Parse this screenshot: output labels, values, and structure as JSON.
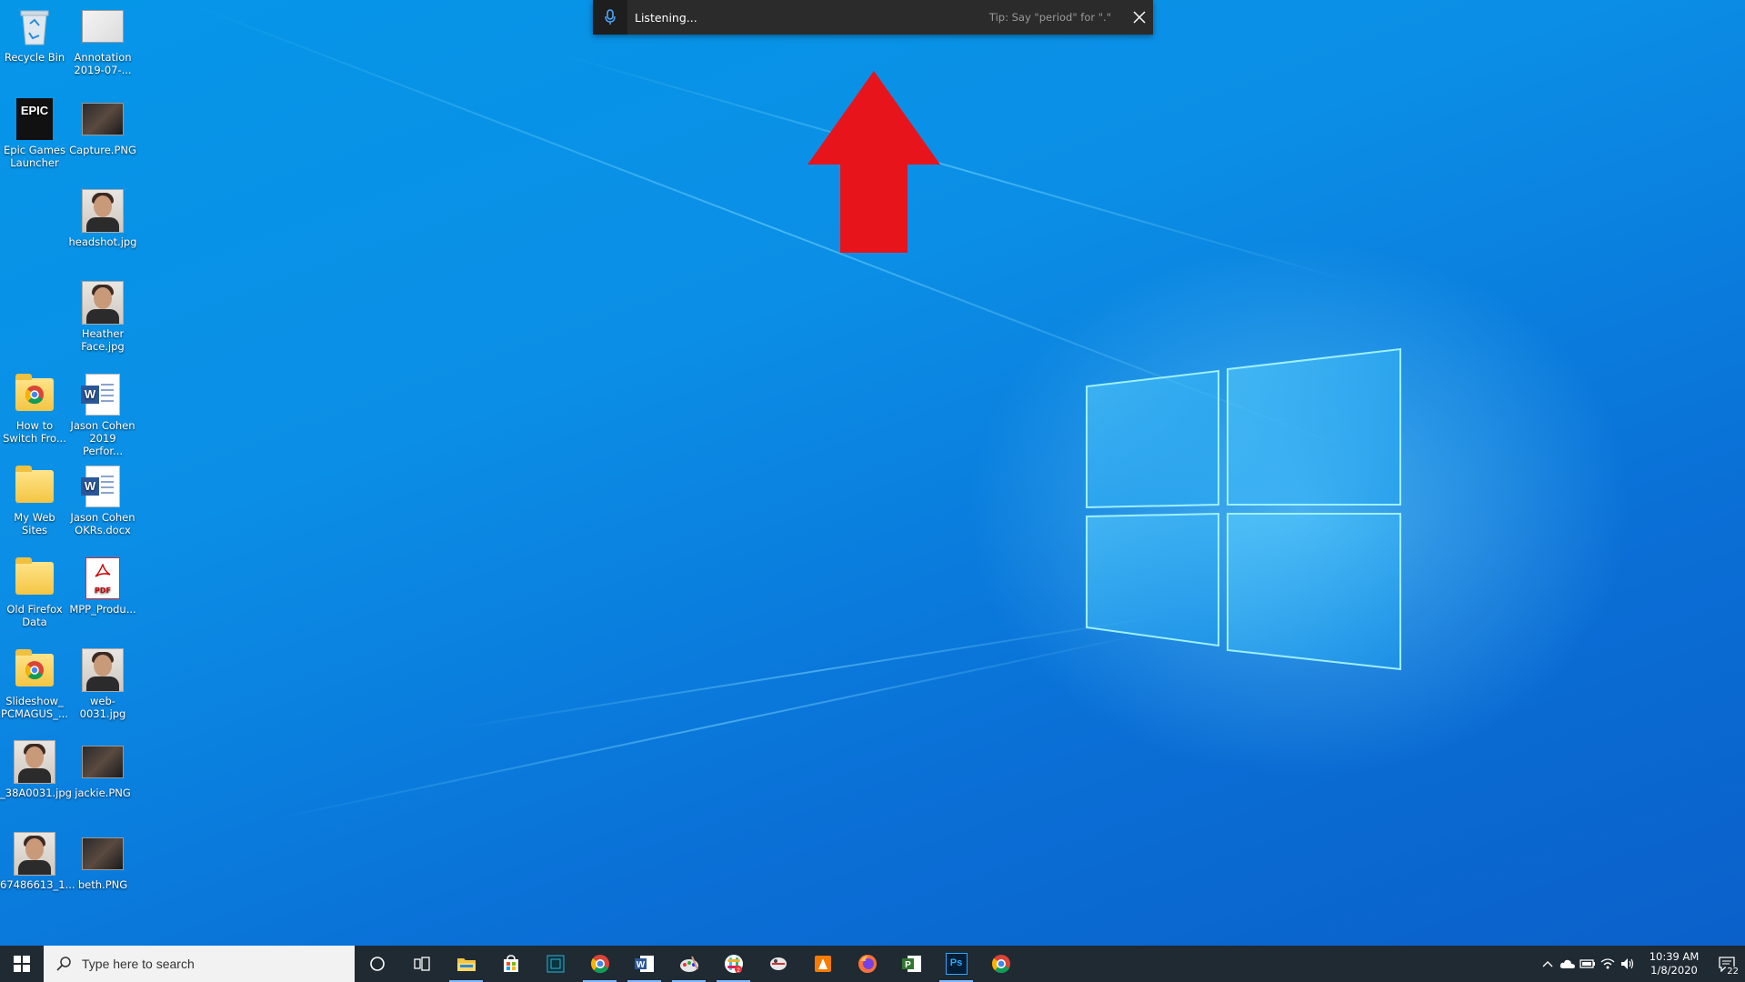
{
  "desktop_icons": [
    {
      "label": "Recycle Bin",
      "icon": "recycle-bin-icon"
    },
    {
      "label": "Annotation\n2019-07-...",
      "icon": "image-file-icon"
    },
    {
      "label": "Epic Games\nLauncher",
      "icon": "epic-games-icon",
      "logo_text": "EPIC"
    },
    {
      "label": "Capture.PNG",
      "icon": "image-file-icon"
    },
    {
      "label": "headshot.jpg",
      "icon": "photo-icon"
    },
    {
      "label": "Heather\nFace.jpg",
      "icon": "photo-icon"
    },
    {
      "label": "How to\nSwitch Fro...",
      "icon": "chrome-folder-icon"
    },
    {
      "label": "Jason Cohen\n2019 Perfor...",
      "icon": "word-doc-icon"
    },
    {
      "label": "My Web Sites",
      "icon": "folder-icon"
    },
    {
      "label": "Jason Cohen\nOKRs.docx",
      "icon": "word-doc-icon"
    },
    {
      "label": "Old Firefox\nData",
      "icon": "folder-icon"
    },
    {
      "label": "MPP_Produ...",
      "icon": "pdf-icon"
    },
    {
      "label": "Slideshow_\nPCMAGUS_...",
      "icon": "chrome-folder-icon"
    },
    {
      "label": "web-0031.jpg",
      "icon": "photo-icon"
    },
    {
      "label": "_38A0031.jpg",
      "icon": "photo-icon"
    },
    {
      "label": "jackie.PNG",
      "icon": "image-file-icon"
    },
    {
      "label": "67486613_1...",
      "icon": "photo-icon"
    },
    {
      "label": "beth.PNG",
      "icon": "image-file-icon"
    }
  ],
  "voice_bar": {
    "status": "Listening...",
    "tip": "Tip: Say \"period\" for \".\"",
    "mic_icon": "microphone-icon",
    "close_icon": "close-icon"
  },
  "taskbar": {
    "search_placeholder": "Type here to search",
    "apps": [
      {
        "name": "cortana",
        "icon": "cortana-icon",
        "active": false
      },
      {
        "name": "task-view",
        "icon": "task-view-icon",
        "active": false
      },
      {
        "name": "file-explorer",
        "icon": "folder-icon",
        "active": true
      },
      {
        "name": "store",
        "icon": "store-icon",
        "active": false
      },
      {
        "name": "app-dark",
        "icon": "app-icon",
        "active": false
      },
      {
        "name": "chrome",
        "icon": "chrome-icon",
        "active": true
      },
      {
        "name": "word",
        "icon": "word-icon",
        "active": true
      },
      {
        "name": "paint",
        "icon": "paint-icon",
        "active": true
      },
      {
        "name": "slack",
        "icon": "slack-icon",
        "active": true
      },
      {
        "name": "snip",
        "icon": "snip-icon",
        "active": false
      },
      {
        "name": "vlc",
        "icon": "vlc-icon",
        "active": false
      },
      {
        "name": "firefox",
        "icon": "firefox-icon",
        "active": false
      },
      {
        "name": "project",
        "icon": "project-icon",
        "active": false
      },
      {
        "name": "photoshop",
        "icon": "photoshop-icon",
        "active": true
      },
      {
        "name": "chrome-2",
        "icon": "chrome-icon",
        "active": false
      }
    ],
    "clock_time": "10:39 AM",
    "clock_date": "1/8/2020",
    "notification_count": "22",
    "ps_label": "Ps"
  },
  "colors": {
    "arrow": "#e8141c",
    "taskbar": "#1f2a33",
    "voice_bar": "#2b2b2b"
  }
}
